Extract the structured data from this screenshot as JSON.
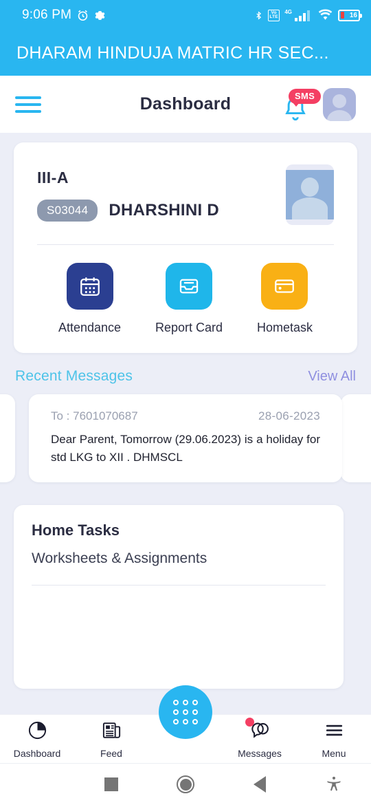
{
  "status_bar": {
    "time": "9:06 PM",
    "alarm_icon": "alarm-clock-icon",
    "settings_icon": "gear-icon",
    "bluetooth_icon": "bluetooth-icon",
    "volte_label": "Vo LTE",
    "network_label": "4G",
    "wifi_icon": "wifi-icon",
    "battery_percent": "16"
  },
  "title_bar": {
    "school_name": "DHARAM HINDUJA MATRIC HR SEC..."
  },
  "app_bar": {
    "menu_icon": "hamburger-menu-icon",
    "title": "Dashboard",
    "notification_badge": "SMS",
    "bell_icon": "bell-icon",
    "avatar_icon": "user-avatar-icon"
  },
  "student": {
    "class": "III-A",
    "id": "S03044",
    "name": "DHARSHINI D",
    "photo_icon": "student-photo-icon",
    "tiles": [
      {
        "label": "Attendance",
        "icon": "calendar-icon",
        "color": "#2b3f91"
      },
      {
        "label": "Report Card",
        "icon": "inbox-tray-icon",
        "color": "#1fb6ea"
      },
      {
        "label": "Hometask",
        "icon": "card-icon",
        "color": "#f9b015"
      }
    ]
  },
  "recent_messages": {
    "title": "Recent Messages",
    "view_all": "View All",
    "items": [
      {
        "to_label": "To : 7601070687",
        "date": "28-06-2023",
        "body": "Dear Parent, Tomorrow (29.06.2023) is a holiday for std LKG to XII . DHMSCL"
      }
    ]
  },
  "home_tasks": {
    "title": "Home Tasks",
    "subtitle": "Worksheets & Assignments"
  },
  "bottom_nav": {
    "items": [
      {
        "label": "Dashboard",
        "icon": "pie-chart-icon"
      },
      {
        "label": "Feed",
        "icon": "newspaper-icon"
      },
      {
        "label": "Messages",
        "icon": "chat-bubbles-icon"
      },
      {
        "label": "Menu",
        "icon": "hamburger-menu-icon"
      }
    ],
    "fab_icon": "apps-grid-icon"
  },
  "android_nav": {
    "recents_icon": "square-recents-icon",
    "home_icon": "circle-home-icon",
    "back_icon": "triangle-back-icon",
    "accessibility_icon": "accessibility-icon"
  },
  "colors": {
    "brand_blue": "#29b6f0",
    "accent_pink": "#f43f63",
    "link_purple": "#8f8fe0",
    "page_bg": "#eceef7"
  }
}
